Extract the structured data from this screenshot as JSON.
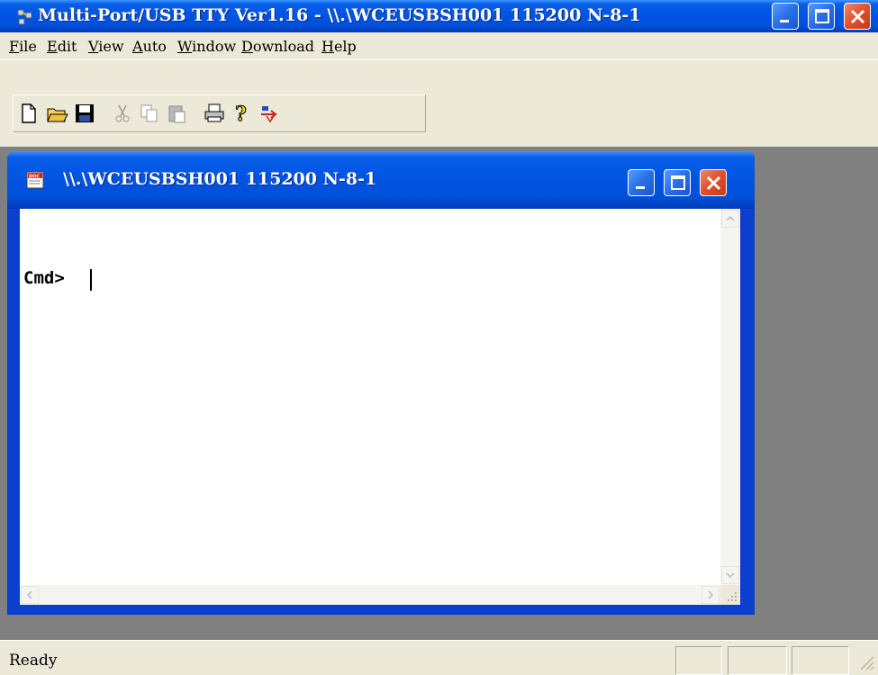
{
  "app": {
    "title": "Multi-Port/USB TTY Ver1.16 - \\\\.\\WCEUSBSH001 115200  N-8-1",
    "icon": "serial-port-icon"
  },
  "menu": {
    "items": [
      {
        "label": "File"
      },
      {
        "label": "Edit"
      },
      {
        "label": "View"
      },
      {
        "label": "Auto"
      },
      {
        "label": "Window"
      },
      {
        "label": "Download"
      },
      {
        "label": "Help"
      }
    ]
  },
  "toolbar": {
    "buttons": [
      {
        "name": "new-document-icon",
        "enabled": true
      },
      {
        "name": "open-folder-icon",
        "enabled": true
      },
      {
        "name": "save-disk-icon",
        "enabled": true
      },
      {
        "name": "cut-scissors-icon",
        "enabled": false
      },
      {
        "name": "copy-icon",
        "enabled": false
      },
      {
        "name": "paste-icon",
        "enabled": false
      },
      {
        "name": "print-icon",
        "enabled": true
      },
      {
        "name": "help-question-icon",
        "enabled": true
      },
      {
        "name": "download-arrow-icon",
        "enabled": true
      }
    ]
  },
  "child_window": {
    "title": "\\\\.\\WCEUSBSH001 115200  N-8-1",
    "icon": "doc-icon",
    "prompt": "Cmd>"
  },
  "status": {
    "text": "Ready"
  },
  "colors": {
    "title_blue": "#0054e3",
    "face": "#ece9d8",
    "mdi_background": "#808080",
    "close_red": "#e0502a"
  }
}
